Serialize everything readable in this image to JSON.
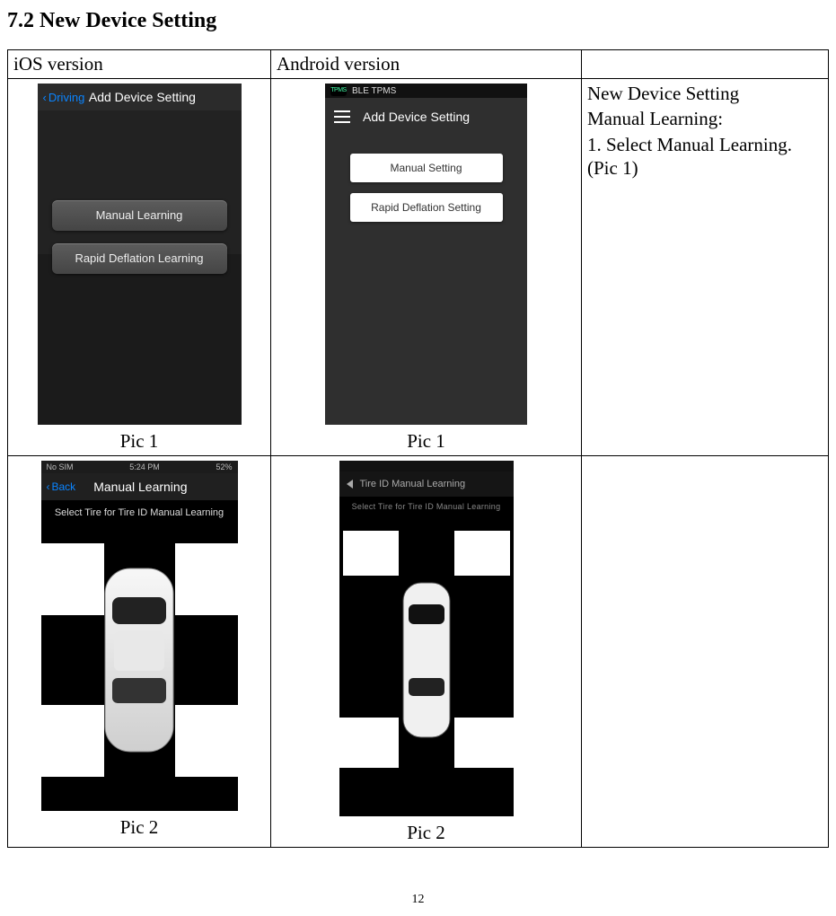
{
  "heading": "7.2 New Device Setting",
  "table_header": {
    "col1": "iOS version",
    "col2": "Android version"
  },
  "row1": {
    "ios": {
      "navbar_back": "Driving",
      "navbar_title": "Add Device Setting",
      "btn_manual": "Manual Learning",
      "btn_rapid": "Rapid Deflation Learning",
      "caption": "Pic 1"
    },
    "android": {
      "status_app": "BLE TPMS",
      "title": "Add  Device Setting",
      "btn_manual": "Manual Setting",
      "btn_rapid": "Rapid Deflation Setting",
      "caption": "Pic 1"
    },
    "instructions": {
      "line1": "New Device Setting",
      "line2": "Manual Learning:",
      "line3": "1. Select Manual Learning. (Pic 1)"
    }
  },
  "row2": {
    "ios": {
      "status_left": "No SIM",
      "status_center": "5:24 PM",
      "status_right": "52%",
      "nav_back": "Back",
      "nav_title": "Manual Learning",
      "subtitle": "Select Tire for Tire ID Manual Learning",
      "caption": "Pic 2"
    },
    "android": {
      "nav_title": "Tire ID Manual Learning",
      "subtitle": "Select Tire for Tire ID Manual Learning",
      "caption": "Pic 2"
    }
  },
  "page_number": "12"
}
